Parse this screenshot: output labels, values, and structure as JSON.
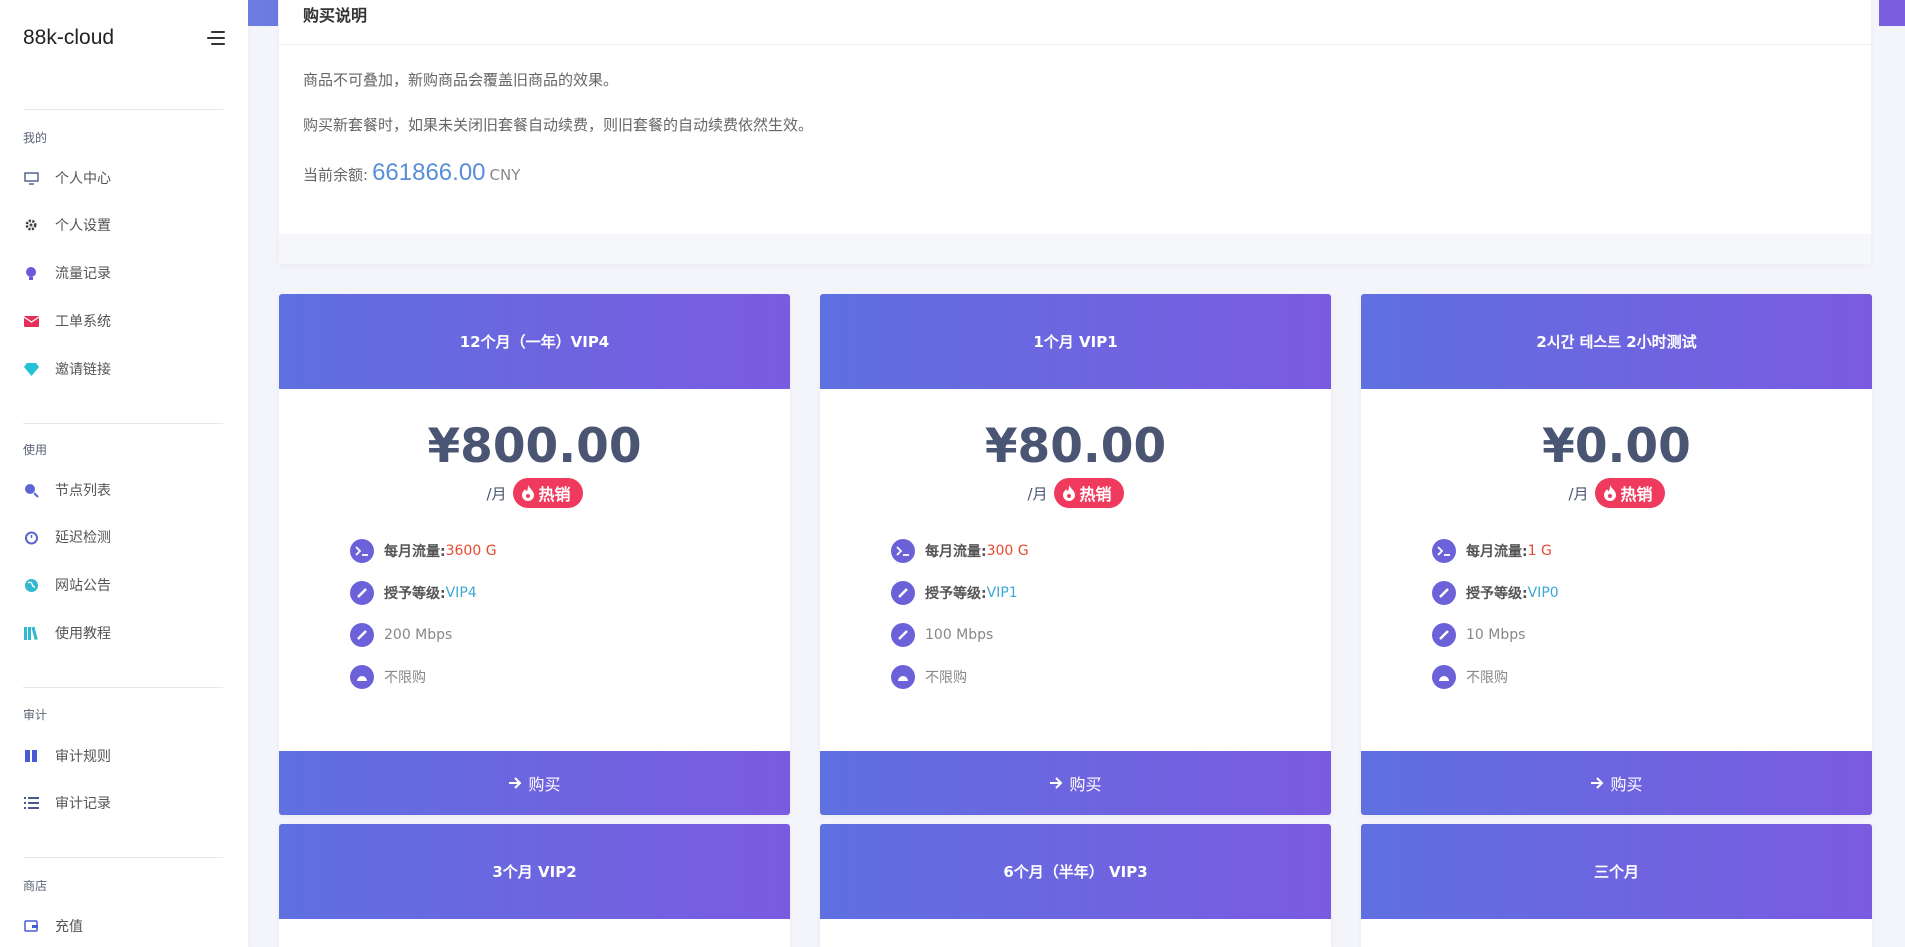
{
  "sidebar": {
    "brand": "88k-cloud",
    "sections": [
      {
        "title": "我的",
        "items": [
          {
            "label": "个人中心",
            "icon": "monitor-icon"
          },
          {
            "label": "个人设置",
            "icon": "gear-icon"
          },
          {
            "label": "流量记录",
            "icon": "bulb-icon"
          },
          {
            "label": "工单系统",
            "icon": "envelope-icon"
          },
          {
            "label": "邀请链接",
            "icon": "diamond-icon"
          }
        ]
      },
      {
        "title": "使用",
        "items": [
          {
            "label": "节点列表",
            "icon": "globe-search-icon"
          },
          {
            "label": "延迟检测",
            "icon": "alarm-icon"
          },
          {
            "label": "网站公告",
            "icon": "globe-icon"
          },
          {
            "label": "使用教程",
            "icon": "books-icon"
          }
        ]
      },
      {
        "title": "审计",
        "items": [
          {
            "label": "审计规则",
            "icon": "book-icon"
          },
          {
            "label": "审计记录",
            "icon": "list-icon"
          }
        ]
      },
      {
        "title": "商店",
        "items": [
          {
            "label": "充值",
            "icon": "wallet-icon"
          }
        ]
      }
    ]
  },
  "info": {
    "title": "购买说明",
    "line1": "商品不可叠加，新购商品会覆盖旧商品的效果。",
    "line2": "购买新套餐时，如果未关闭旧套餐自动续费，则旧套餐的自动续费依然生效。",
    "balance_label": "当前余额:",
    "balance_amount": "661866.00",
    "balance_unit": "CNY"
  },
  "plans": [
    {
      "title": "12个月（一年）VIP4",
      "price": "¥800.00",
      "per": "/月",
      "hot": "热销",
      "traffic_label": "每月流量:",
      "traffic": "3600 G",
      "level_label": "授予等级:",
      "level": "VIP4",
      "speed": "200 Mbps",
      "limit": "不限购",
      "buy": "购买"
    },
    {
      "title": "1个月 VIP1",
      "price": "¥80.00",
      "per": "/月",
      "hot": "热销",
      "traffic_label": "每月流量:",
      "traffic": "300 G",
      "level_label": "授予等级:",
      "level": "VIP1",
      "speed": "100 Mbps",
      "limit": "不限购",
      "buy": "购买"
    },
    {
      "title": "2시간 테스트 2小时测试",
      "price": "¥0.00",
      "per": "/月",
      "hot": "热销",
      "traffic_label": "每月流量:",
      "traffic": "1 G",
      "level_label": "授予等级:",
      "level": "VIP0",
      "speed": "10 Mbps",
      "limit": "不限购",
      "buy": "购买"
    },
    {
      "title": "3个月 VIP2"
    },
    {
      "title": "6个月（半年） VIP3"
    },
    {
      "title": "三个月"
    }
  ],
  "colors": {
    "accent_start": "#5f70e0",
    "accent_end": "#7a5be0",
    "hot": "#ef3a5d",
    "traffic": "#e64a2e",
    "level": "#3ba9d8"
  }
}
